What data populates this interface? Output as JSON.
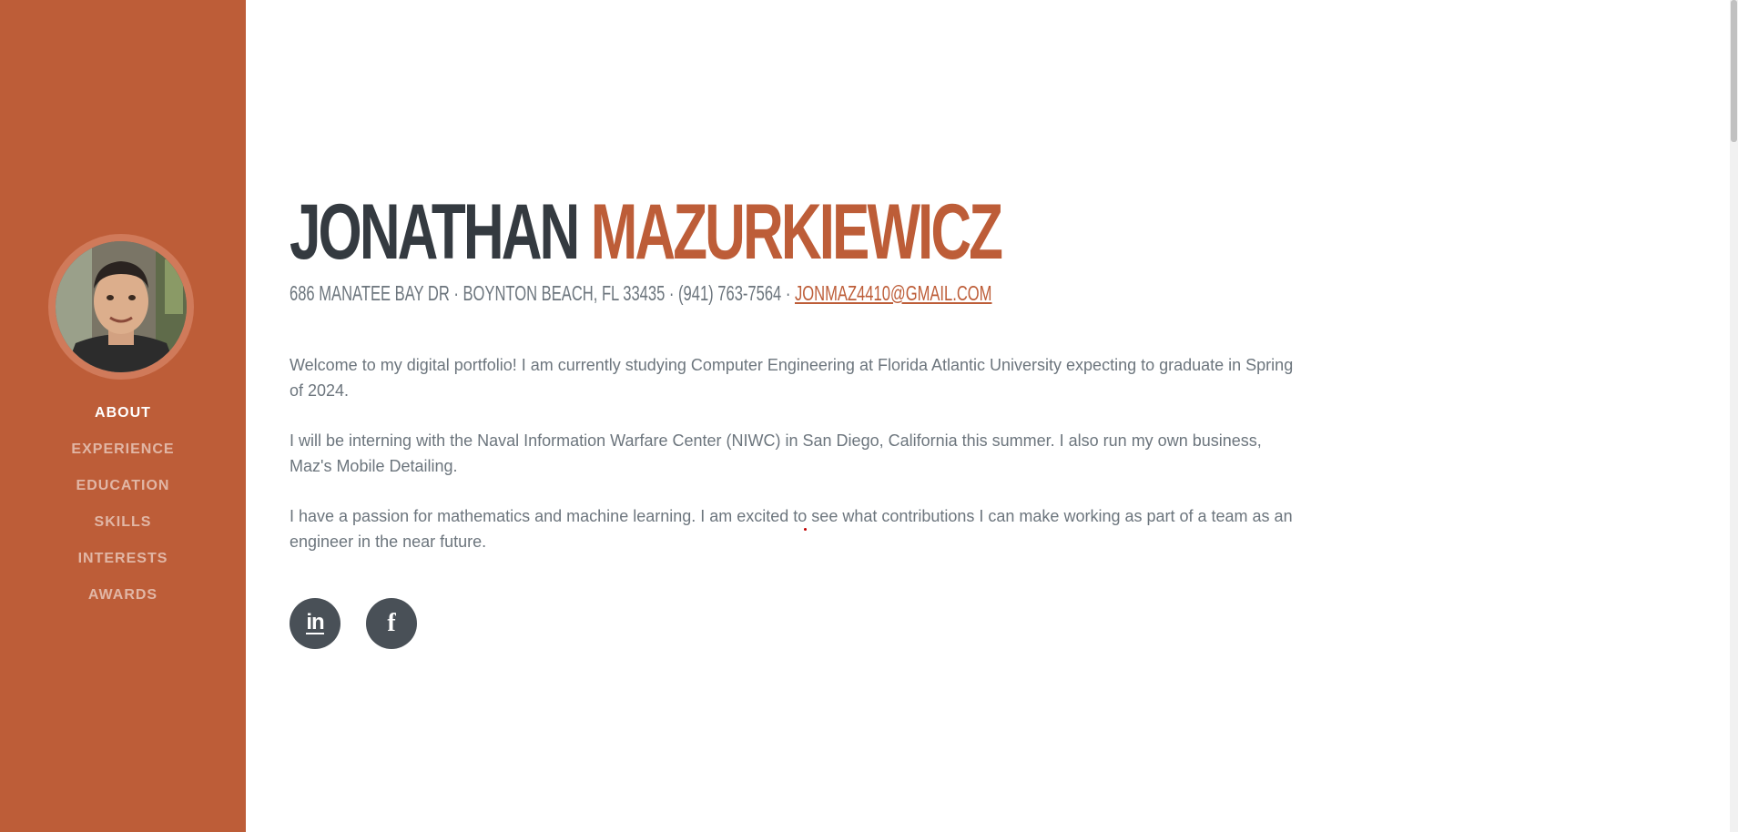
{
  "profile": {
    "first_name": "JONATHAN",
    "last_name": "MAZURKIEWICZ",
    "address": "686 MANATEE BAY DR · BOYNTON BEACH, FL 33435 · (941) 763-7564 · ",
    "email": "JONMAZ4410@GMAIL.COM"
  },
  "nav": {
    "items": [
      {
        "label": "ABOUT",
        "active": true
      },
      {
        "label": "EXPERIENCE",
        "active": false
      },
      {
        "label": "EDUCATION",
        "active": false
      },
      {
        "label": "SKILLS",
        "active": false
      },
      {
        "label": "INTERESTS",
        "active": false
      },
      {
        "label": "AWARDS",
        "active": false
      }
    ]
  },
  "about": {
    "paragraphs": [
      "Welcome to my digital portfolio! I am currently studying Computer Engineering at Florida Atlantic University expecting to graduate in Spring of 2024.",
      "I will be interning with the Naval Information Warfare Center (NIWC) in San Diego, California this summer. I also run my own business, Maz's Mobile Detailing.",
      "I have a passion for mathematics and machine learning. I am excited to see what contributions I can make working as part of a team as an engineer in the near future."
    ]
  },
  "social": {
    "linkedin_icon": "linkedin-icon",
    "facebook_icon": "facebook-icon"
  },
  "colors": {
    "primary": "#bd5d38",
    "dark": "#343a40",
    "muted": "#6c757d",
    "social_bg": "#495057"
  }
}
